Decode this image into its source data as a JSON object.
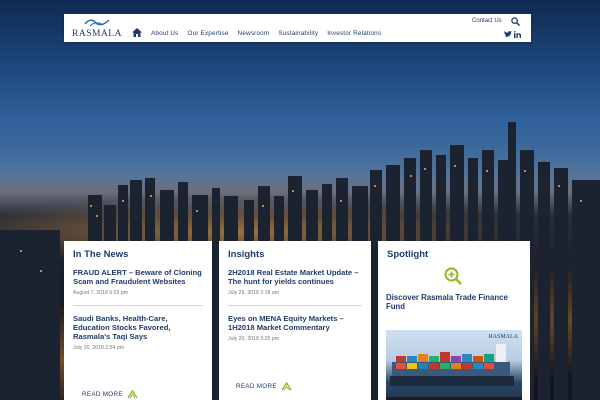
{
  "brand": {
    "name": "RASMALA"
  },
  "header": {
    "nav": [
      "About Us",
      "Our Expertise",
      "Newsroom",
      "Sustainability",
      "Investor Relations"
    ],
    "contact_label": "Contact Us",
    "icons": [
      "home-icon",
      "search-icon",
      "twitter-icon",
      "linkedin-icon"
    ]
  },
  "news": {
    "heading": "In The News",
    "items": [
      {
        "title": "FRAUD ALERT – Beware of Cloning Scam and Fraudulent Websites",
        "date": "August 7, 2018 6:03 pm"
      },
      {
        "title": "Saudi Banks, Health-Care, Education Stocks Favored, Rasmala's Taqi Says",
        "date": "July 26, 2018 2:54 pm"
      }
    ],
    "read_more": "READ MORE"
  },
  "insights": {
    "heading": "Insights",
    "items": [
      {
        "title": "2H2018 Real Estate Market Update – The hunt for yields continues",
        "date": "July 29, 2018 2:18 am"
      },
      {
        "title": "Eyes on MENA Equity Markets – 1H2018 Market Commentary",
        "date": "July 20, 2018 3:25 pm"
      }
    ],
    "read_more": "READ MORE"
  },
  "spotlight": {
    "heading": "Spotlight",
    "title": "Discover Rasmala Trade Finance Fund",
    "video_logo": "RASMALA"
  },
  "colors": {
    "brand_navy": "#1f3b6a",
    "accent_green": "#8dbb26"
  }
}
